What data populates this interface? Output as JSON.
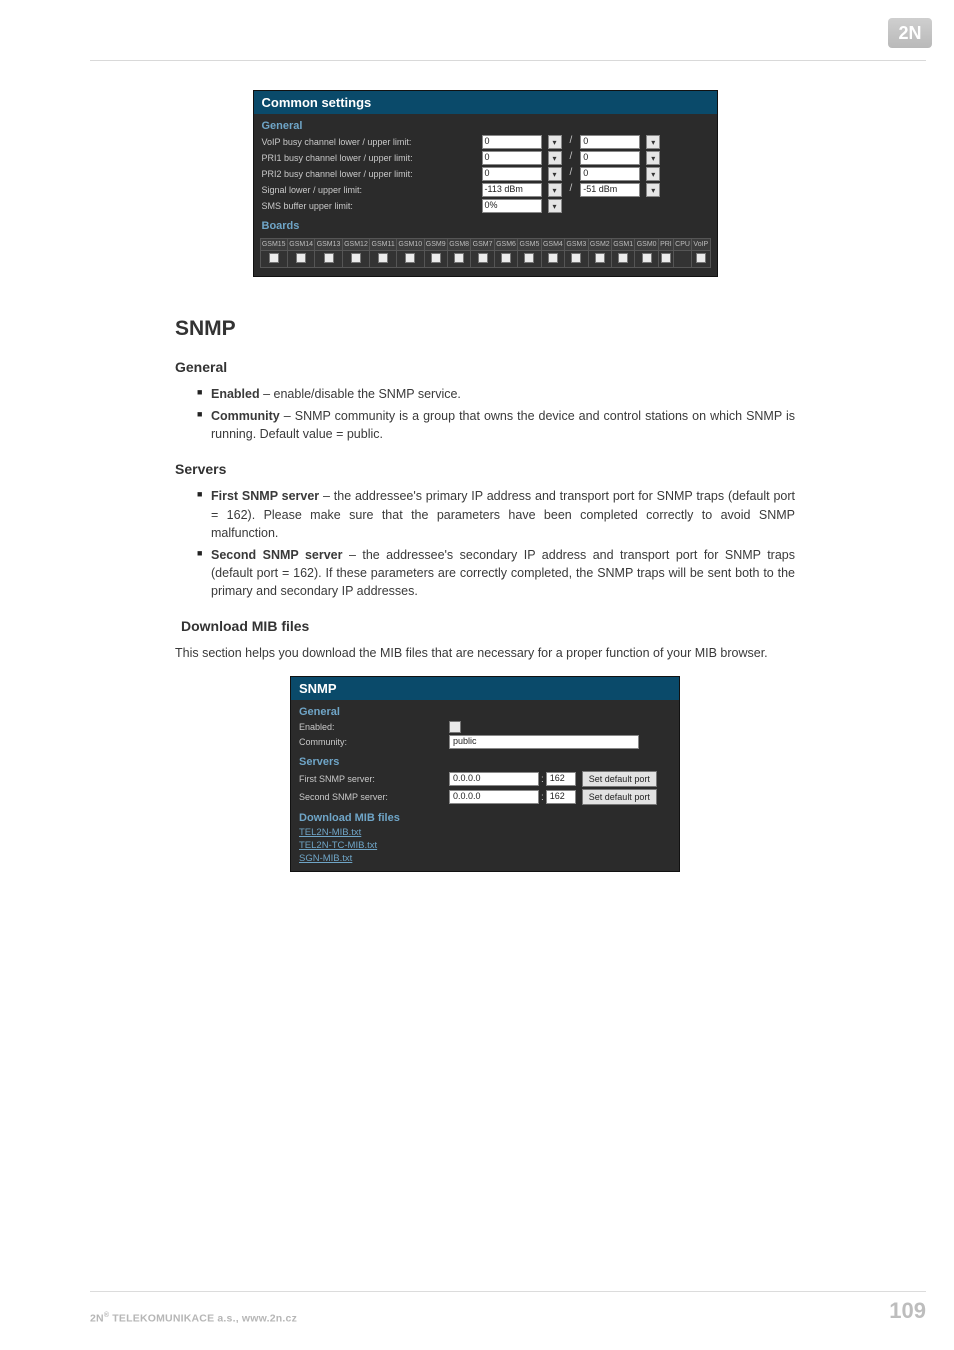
{
  "logo_text": "2N",
  "commons": {
    "title": "Common settings",
    "general_label": "General",
    "rows": [
      {
        "label": "VoIP busy channel lower / upper limit:",
        "a": "0",
        "b": "0"
      },
      {
        "label": "PRI1 busy channel lower / upper limit:",
        "a": "0",
        "b": "0"
      },
      {
        "label": "PRI2 busy channel lower / upper limit:",
        "a": "0",
        "b": "0"
      },
      {
        "label": "Signal lower / upper limit:",
        "a": "-113 dBm",
        "b": "-51 dBm"
      },
      {
        "label": "SMS buffer upper limit:",
        "a": "0%",
        "b": ""
      }
    ],
    "boards_label": "Boards",
    "board_cols": [
      "GSM15",
      "GSM14",
      "GSM13",
      "GSM12",
      "GSM11",
      "GSM10",
      "GSM9",
      "GSM8",
      "GSM7",
      "GSM6",
      "GSM5",
      "GSM4",
      "GSM3",
      "GSM2",
      "GSM1",
      "GSM0",
      "PRI",
      "CPU",
      "VoIP"
    ]
  },
  "snmp_heading": "SNMP",
  "general_heading": "General",
  "general_bullets": [
    {
      "lead": "Enabled",
      "text": " – enable/disable the SNMP service."
    },
    {
      "lead": "Community",
      "text": " – SNMP community is a group that owns the device and control stations on which SNMP is running. Default value = public."
    }
  ],
  "servers_heading": "Servers",
  "servers_bullets": [
    {
      "lead": "First SNMP server",
      "text": " – the addressee's primary IP address and transport port for SNMP traps (default port = 162). Please make sure that the parameters have been completed correctly to avoid SNMP malfunction."
    },
    {
      "lead": "Second SNMP server",
      "text": " – the addressee's secondary IP address and transport port for SNMP traps (default port = 162). If these parameters are correctly completed, the SNMP traps will be sent both to the primary and secondary IP addresses."
    }
  ],
  "download_heading": "Download MIB files",
  "download_text": "This section helps you download the MIB files that are necessary for a proper function of your MIB browser.",
  "snmp_panel": {
    "title": "SNMP",
    "general_label": "General",
    "enabled_label": "Enabled:",
    "community_label": "Community:",
    "community_value": "public",
    "servers_label": "Servers",
    "first_label": "First SNMP server:",
    "second_label": "Second SNMP server:",
    "ip1": "0.0.0.0",
    "port1": "162",
    "ip2": "0.0.0.0",
    "port2": "162",
    "set_default": "Set default port",
    "download_label": "Download MIB files",
    "links": [
      "TEL2N-MIB.txt",
      "TEL2N-TC-MIB.txt",
      "SGN-MIB.txt"
    ]
  },
  "footer": {
    "left": "2N® TELEKOMUNIKACE a.s., www.2n.cz",
    "page": "109"
  }
}
